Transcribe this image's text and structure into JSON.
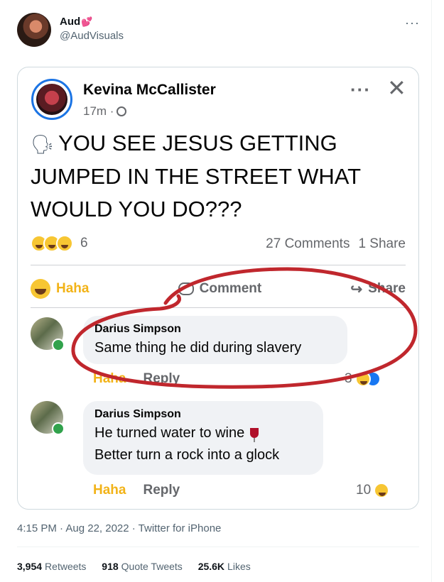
{
  "tweet": {
    "author_name": "Aud",
    "author_emoji": "💕",
    "handle": "@AudVisuals",
    "more_label": "···",
    "timestamp": "4:15 PM · Aug 22, 2022 · Twitter for iPhone",
    "stats": [
      {
        "value": "3,954",
        "label": "Retweets"
      },
      {
        "value": "918",
        "label": "Quote Tweets"
      },
      {
        "value": "25.6K",
        "label": "Likes"
      }
    ]
  },
  "fb_post": {
    "author": "Kevina McCallister",
    "meta": "17m ·",
    "text": "YOU SEE JESUS GETTING JUMPED IN THE STREET WHAT WOULD YOU DO???",
    "reaction_count": "6",
    "comments_count": "27 Comments",
    "shares_count": "1 Share",
    "actions": {
      "haha": "Haha",
      "comment": "Comment",
      "share": "Share"
    },
    "comments": [
      {
        "author": "Darius Simpson",
        "lines": [
          "Same thing he did during slavery"
        ],
        "haha": "Haha",
        "reply": "Reply",
        "reaction_count": "3"
      },
      {
        "author": "Darius Simpson",
        "lines": [
          "He turned water to wine",
          "Better turn a rock into a glock"
        ],
        "haha": "Haha",
        "reply": "Reply",
        "reaction_count": "10"
      }
    ]
  },
  "colors": {
    "facebook_blue": "#1b74e4",
    "haha_yellow": "#f2b318",
    "annotation_red": "#c0272d",
    "twitter_gray": "#536471"
  },
  "icons": [
    "speaking-head-icon",
    "globe-icon",
    "haha-icon",
    "comment-icon",
    "share-icon",
    "like-icon",
    "wine-glass-icon",
    "close-icon"
  ]
}
